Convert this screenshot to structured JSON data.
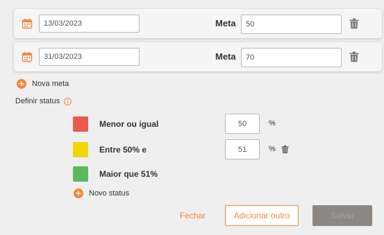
{
  "metas": [
    {
      "date": "13/03/2023",
      "label": "Meta",
      "value": "50"
    },
    {
      "date": "31/03/2023",
      "label": "Meta",
      "value": "70"
    }
  ],
  "nova_meta_label": "Nova meta",
  "definir_status_label": "Definir status",
  "status": [
    {
      "label": "Menor ou igual",
      "value": "50",
      "unit": "%",
      "color": "#e85a4a"
    },
    {
      "label": "Entre 50% e",
      "value": "51",
      "unit": "%",
      "color": "#f2d600"
    },
    {
      "label": "Maior que 51%",
      "color": "#5cb85c"
    }
  ],
  "novo_status_label": "Novo status",
  "buttons": {
    "fechar": "Fechar",
    "adicionar_outro": "Adicionar outro",
    "salvar": "Salvar"
  },
  "colors": {
    "accent": "#f0883e",
    "icon_gray": "#777777",
    "disabled_button": "#8c8782"
  },
  "icons": {
    "calendar": "calendar-icon",
    "trash": "trash-icon",
    "plus": "plus-circle-icon",
    "info": "info-icon"
  }
}
